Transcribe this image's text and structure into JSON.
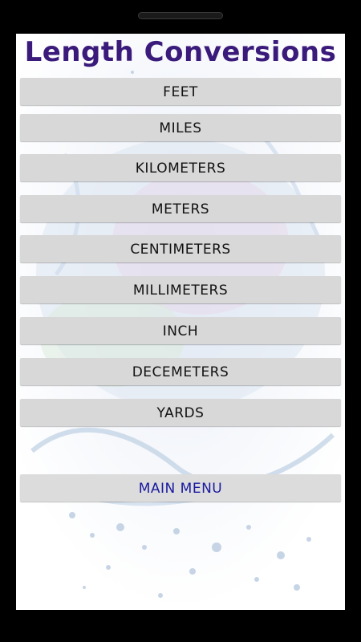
{
  "title": "Length Conversions",
  "buttons": {
    "feet": "FEET",
    "miles": "MILES",
    "kilometers": "KILOMETERS",
    "meters": "METERS",
    "centimeters": "CENTIMETERS",
    "millimeters": "MILLIMETERS",
    "inch": "INCH",
    "decemeters": "DECEMETERS",
    "yards": "YARDS",
    "main_menu": "MAIN MENU"
  },
  "colors": {
    "title": "#3a1a7a",
    "main_menu_text": "#1a1aa0",
    "button_bg": "#d8d8d8"
  }
}
